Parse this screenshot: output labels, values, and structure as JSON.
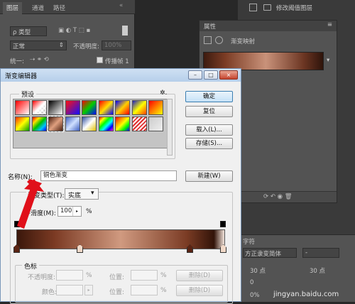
{
  "layers_panel": {
    "tabs": [
      "图层",
      "通道",
      "路径"
    ],
    "filter_kind": "ρ 类型",
    "blend_mode": "正常",
    "opacity_label": "不透明度:",
    "opacity_value": "100%",
    "unify_label": "统一:",
    "propagate_label": "传播帧 1"
  },
  "right_panel": {
    "layer_name": "修改阈值图层"
  },
  "properties_panel": {
    "title": "属性",
    "adjustment_name": "渐变映射"
  },
  "character_panel": {
    "title": "字符",
    "font_family": "方正隶变简体",
    "font_style": "-",
    "size": "30 点",
    "leading": "30 点",
    "tracking": "0",
    "scale": "0%"
  },
  "watermark": "jingyan.baidu.com",
  "gradient_editor": {
    "window_title": "渐变编辑器",
    "window_buttons": {
      "minimize": "–",
      "maximize": "□",
      "close": "×"
    },
    "presets_label": "预设",
    "preset_menu": "✲.",
    "buttons": {
      "ok": "确定",
      "reset": "复位",
      "load": "载入(L)...",
      "save": "存储(S)...",
      "new": "新建(W)"
    },
    "name_label": "名称(N):",
    "name_value": "铜色渐变",
    "gradient_type_label": "渐变类型(T):",
    "gradient_type_value": "实底",
    "smoothness_label": "平滑度(M):",
    "smoothness_value": "100",
    "smoothness_unit": "%",
    "color_stops": {
      "section_label": "色标",
      "opacity_label": "不透明度:",
      "opacity_unit": "%",
      "color_label": "颜色:",
      "location_label": "位置:",
      "location_unit": "%",
      "delete_label": "删除(D)"
    },
    "preset_swatches": [
      "linear-gradient(135deg,#ff0000,#ffffff)",
      "linear-gradient(135deg,#ff0000,#ffffff 50%,transparent)",
      "linear-gradient(135deg,#000000,#ffffff)",
      "linear-gradient(135deg,#ff1010,#1010ff)",
      "linear-gradient(135deg,#ff0000,#00cc00,#0000ff)",
      "linear-gradient(135deg,#ff0000,#ffe000,#0000ff)",
      "linear-gradient(135deg,#0000ff,#ffd000,#ff0000)",
      "linear-gradient(135deg,#2020c0,#ffff00,#ff4000)",
      "linear-gradient(135deg,#ff0000,#ff8000,#ffff00)",
      "linear-gradient(135deg,#ff3000,#ffff00,#00a000)",
      "linear-gradient(135deg,#ff0000,#ffe000,#00c000,#00c0ff,#0000ff)",
      "linear-gradient(135deg,#4b2010,#e0a080,#4b2010)",
      "linear-gradient(135deg,#4060c0,#d0e0ff,#4060c0)",
      "linear-gradient(135deg,#3050a0,#ffffff,#e0c000)",
      "linear-gradient(135deg,#ff0000,#ffff00,#00ff00,#00ffff,#0000ff,#ff00ff)",
      "linear-gradient(135deg,#ff0000,#ff8800,#ffff00,#00ff00,#0000ff)",
      "repeating-linear-gradient(135deg,#e03030 0 2px,#ffffff 2px 4px)",
      "linear-gradient(135deg,#cccccc,#eeeeee)"
    ],
    "gradient_colors": {
      "stop_dark": "#3a170b",
      "stop_light": "#f1d9c8",
      "ok_border": "#3c7fb1",
      "arrow": "#e0101a"
    }
  }
}
